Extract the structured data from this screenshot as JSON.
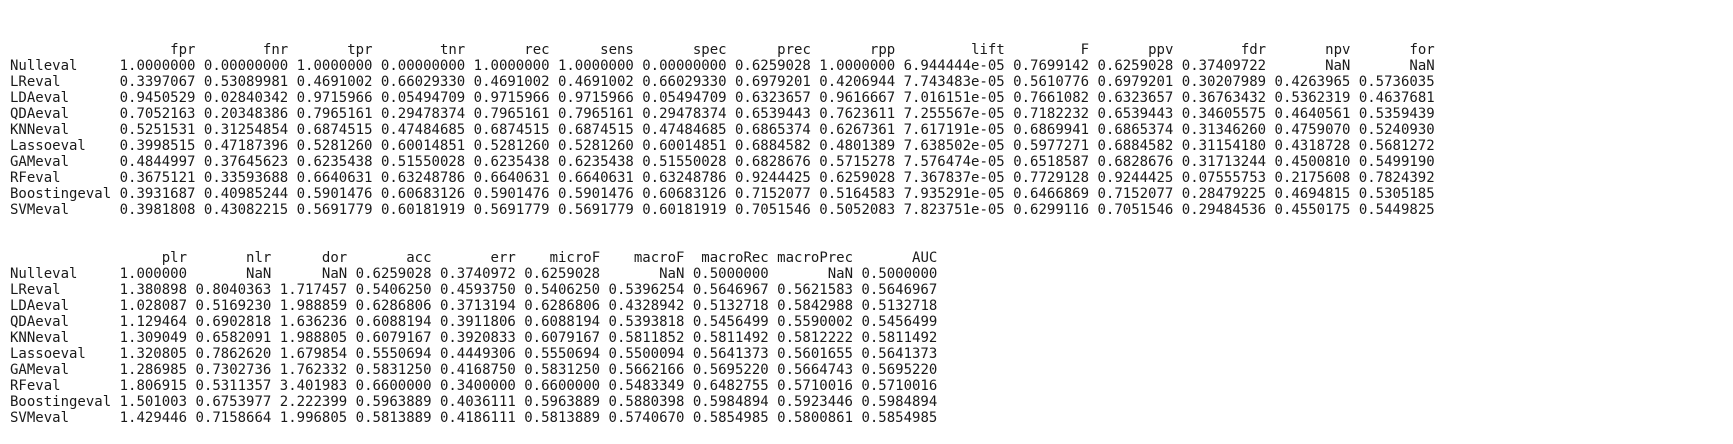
{
  "table1": {
    "corner": "",
    "headers": [
      "fpr",
      "fnr",
      "tpr",
      "tnr",
      "rec",
      "sens",
      "spec",
      "prec",
      "rpp",
      "lift",
      "F",
      "ppv",
      "fdr",
      "npv",
      "for"
    ],
    "rows": [
      {
        "name": "Nulleval",
        "values": [
          "1.0000000",
          "0.00000000",
          "1.0000000",
          "0.00000000",
          "1.0000000",
          "1.0000000",
          "0.00000000",
          "0.6259028",
          "1.0000000",
          "6.944444e-05",
          "0.7699142",
          "0.6259028",
          "0.37409722",
          "NaN",
          "NaN"
        ]
      },
      {
        "name": "LReval",
        "values": [
          "0.3397067",
          "0.53089981",
          "0.4691002",
          "0.66029330",
          "0.4691002",
          "0.4691002",
          "0.66029330",
          "0.6979201",
          "0.4206944",
          "7.743483e-05",
          "0.5610776",
          "0.6979201",
          "0.30207989",
          "0.4263965",
          "0.5736035"
        ]
      },
      {
        "name": "LDAeval",
        "values": [
          "0.9450529",
          "0.02840342",
          "0.9715966",
          "0.05494709",
          "0.9715966",
          "0.9715966",
          "0.05494709",
          "0.6323657",
          "0.9616667",
          "7.016151e-05",
          "0.7661082",
          "0.6323657",
          "0.36763432",
          "0.5362319",
          "0.4637681"
        ]
      },
      {
        "name": "QDAeval",
        "values": [
          "0.7052163",
          "0.20348386",
          "0.7965161",
          "0.29478374",
          "0.7965161",
          "0.7965161",
          "0.29478374",
          "0.6539443",
          "0.7623611",
          "7.255567e-05",
          "0.7182232",
          "0.6539443",
          "0.34605575",
          "0.4640561",
          "0.5359439"
        ]
      },
      {
        "name": "KNNeval",
        "values": [
          "0.5251531",
          "0.31254854",
          "0.6874515",
          "0.47484685",
          "0.6874515",
          "0.6874515",
          "0.47484685",
          "0.6865374",
          "0.6267361",
          "7.617191e-05",
          "0.6869941",
          "0.6865374",
          "0.31346260",
          "0.4759070",
          "0.5240930"
        ]
      },
      {
        "name": "Lassoeval",
        "values": [
          "0.3998515",
          "0.47187396",
          "0.5281260",
          "0.60014851",
          "0.5281260",
          "0.5281260",
          "0.60014851",
          "0.6884582",
          "0.4801389",
          "7.638502e-05",
          "0.5977271",
          "0.6884582",
          "0.31154180",
          "0.4318728",
          "0.5681272"
        ]
      },
      {
        "name": "GAMeval",
        "values": [
          "0.4844997",
          "0.37645623",
          "0.6235438",
          "0.51550028",
          "0.6235438",
          "0.6235438",
          "0.51550028",
          "0.6828676",
          "0.5715278",
          "7.576474e-05",
          "0.6518587",
          "0.6828676",
          "0.31713244",
          "0.4500810",
          "0.5499190"
        ]
      },
      {
        "name": "RFeval",
        "values": [
          "0.3675121",
          "0.33593688",
          "0.6640631",
          "0.63248786",
          "0.6640631",
          "0.6640631",
          "0.63248786",
          "0.9244425",
          "0.6259028",
          "7.367837e-05",
          "0.7729128",
          "0.9244425",
          "0.07555753",
          "0.2175608",
          "0.7824392"
        ]
      },
      {
        "name": "Boostingeval",
        "values": [
          "0.3931687",
          "0.40985244",
          "0.5901476",
          "0.60683126",
          "0.5901476",
          "0.5901476",
          "0.60683126",
          "0.7152077",
          "0.5164583",
          "7.935291e-05",
          "0.6466869",
          "0.7152077",
          "0.28479225",
          "0.4694815",
          "0.5305185"
        ]
      },
      {
        "name": "SVMeval",
        "values": [
          "0.3981808",
          "0.43082215",
          "0.5691779",
          "0.60181919",
          "0.5691779",
          "0.5691779",
          "0.60181919",
          "0.7051546",
          "0.5052083",
          "7.823751e-05",
          "0.6299116",
          "0.7051546",
          "0.29484536",
          "0.4550175",
          "0.5449825"
        ]
      }
    ]
  },
  "table2": {
    "corner": "",
    "headers": [
      "plr",
      "nlr",
      "dor",
      "acc",
      "err",
      "microF",
      "macroF",
      "macroRec",
      "macroPrec",
      "AUC"
    ],
    "rows": [
      {
        "name": "Nulleval",
        "values": [
          "1.000000",
          "NaN",
          "NaN",
          "0.6259028",
          "0.3740972",
          "0.6259028",
          "NaN",
          "0.5000000",
          "NaN",
          "0.5000000"
        ]
      },
      {
        "name": "LReval",
        "values": [
          "1.380898",
          "0.8040363",
          "1.717457",
          "0.5406250",
          "0.4593750",
          "0.5406250",
          "0.5396254",
          "0.5646967",
          "0.5621583",
          "0.5646967"
        ]
      },
      {
        "name": "LDAeval",
        "values": [
          "1.028087",
          "0.5169230",
          "1.988859",
          "0.6286806",
          "0.3713194",
          "0.6286806",
          "0.4328942",
          "0.5132718",
          "0.5842988",
          "0.5132718"
        ]
      },
      {
        "name": "QDAeval",
        "values": [
          "1.129464",
          "0.6902818",
          "1.636236",
          "0.6088194",
          "0.3911806",
          "0.6088194",
          "0.5393818",
          "0.5456499",
          "0.5590002",
          "0.5456499"
        ]
      },
      {
        "name": "KNNeval",
        "values": [
          "1.309049",
          "0.6582091",
          "1.988805",
          "0.6079167",
          "0.3920833",
          "0.6079167",
          "0.5811852",
          "0.5811492",
          "0.5812222",
          "0.5811492"
        ]
      },
      {
        "name": "Lassoeval",
        "values": [
          "1.320805",
          "0.7862620",
          "1.679854",
          "0.5550694",
          "0.4449306",
          "0.5550694",
          "0.5500094",
          "0.5641373",
          "0.5601655",
          "0.5641373"
        ]
      },
      {
        "name": "GAMeval",
        "values": [
          "1.286985",
          "0.7302736",
          "1.762332",
          "0.5831250",
          "0.4168750",
          "0.5831250",
          "0.5662166",
          "0.5695220",
          "0.5664743",
          "0.5695220"
        ]
      },
      {
        "name": "RFeval",
        "values": [
          "1.806915",
          "0.5311357",
          "3.401983",
          "0.6600000",
          "0.3400000",
          "0.6600000",
          "0.5483349",
          "0.6482755",
          "0.5710016",
          "0.5710016"
        ]
      },
      {
        "name": "Boostingeval",
        "values": [
          "1.501003",
          "0.6753977",
          "2.222399",
          "0.5963889",
          "0.4036111",
          "0.5963889",
          "0.5880398",
          "0.5984894",
          "0.5923446",
          "0.5984894"
        ]
      },
      {
        "name": "SVMeval",
        "values": [
          "1.429446",
          "0.7158664",
          "1.996805",
          "0.5813889",
          "0.4186111",
          "0.5813889",
          "0.5740670",
          "0.5854985",
          "0.5800861",
          "0.5854985"
        ]
      }
    ]
  }
}
